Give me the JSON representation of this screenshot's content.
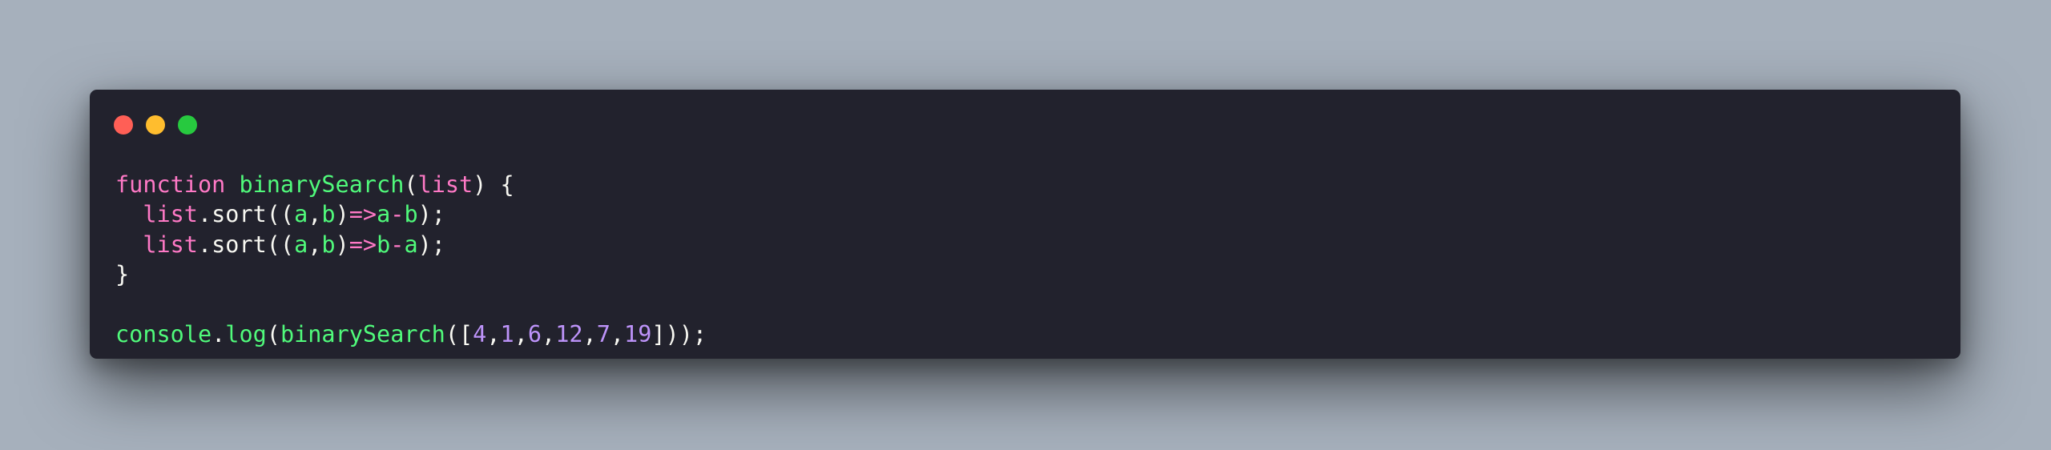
{
  "colors": {
    "background": "#a6b0bc",
    "window": "#22222d",
    "close_dot": "#ff5f56",
    "minimize_dot": "#ffbd2e",
    "maximize_dot": "#27c93f",
    "text": "#f8f8f2",
    "keyword": "#ff79c6",
    "function": "#50fa7b",
    "number": "#bd93f9"
  },
  "code_lines": [
    {
      "tokens": [
        {
          "text": "function",
          "type": "keyword"
        },
        {
          "text": " ",
          "type": "plain"
        },
        {
          "text": "binarySearch",
          "type": "func"
        },
        {
          "text": "(",
          "type": "plain"
        },
        {
          "text": "list",
          "type": "var"
        },
        {
          "text": ") {",
          "type": "plain"
        }
      ]
    },
    {
      "tokens": [
        {
          "text": "  ",
          "type": "plain"
        },
        {
          "text": "list",
          "type": "var"
        },
        {
          "text": ".sort((",
          "type": "plain"
        },
        {
          "text": "a",
          "type": "param"
        },
        {
          "text": ",",
          "type": "plain"
        },
        {
          "text": "b",
          "type": "param"
        },
        {
          "text": ")",
          "type": "plain"
        },
        {
          "text": "=>",
          "type": "op"
        },
        {
          "text": "a",
          "type": "param"
        },
        {
          "text": "-",
          "type": "op"
        },
        {
          "text": "b",
          "type": "param"
        },
        {
          "text": ");",
          "type": "plain"
        }
      ]
    },
    {
      "tokens": [
        {
          "text": "  ",
          "type": "plain"
        },
        {
          "text": "list",
          "type": "var"
        },
        {
          "text": ".sort((",
          "type": "plain"
        },
        {
          "text": "a",
          "type": "param"
        },
        {
          "text": ",",
          "type": "plain"
        },
        {
          "text": "b",
          "type": "param"
        },
        {
          "text": ")",
          "type": "plain"
        },
        {
          "text": "=>",
          "type": "op"
        },
        {
          "text": "b",
          "type": "param"
        },
        {
          "text": "-",
          "type": "op"
        },
        {
          "text": "a",
          "type": "param"
        },
        {
          "text": ");",
          "type": "plain"
        }
      ]
    },
    {
      "tokens": [
        {
          "text": "}",
          "type": "plain"
        }
      ]
    },
    {
      "tokens": []
    },
    {
      "tokens": [
        {
          "text": "console",
          "type": "func"
        },
        {
          "text": ".",
          "type": "plain"
        },
        {
          "text": "log",
          "type": "func"
        },
        {
          "text": "(",
          "type": "plain"
        },
        {
          "text": "binarySearch",
          "type": "func"
        },
        {
          "text": "([",
          "type": "plain"
        },
        {
          "text": "4",
          "type": "num"
        },
        {
          "text": ",",
          "type": "plain"
        },
        {
          "text": "1",
          "type": "num"
        },
        {
          "text": ",",
          "type": "plain"
        },
        {
          "text": "6",
          "type": "num"
        },
        {
          "text": ",",
          "type": "plain"
        },
        {
          "text": "12",
          "type": "num"
        },
        {
          "text": ",",
          "type": "plain"
        },
        {
          "text": "7",
          "type": "num"
        },
        {
          "text": ",",
          "type": "plain"
        },
        {
          "text": "19",
          "type": "num"
        },
        {
          "text": "]));",
          "type": "plain"
        }
      ]
    }
  ]
}
